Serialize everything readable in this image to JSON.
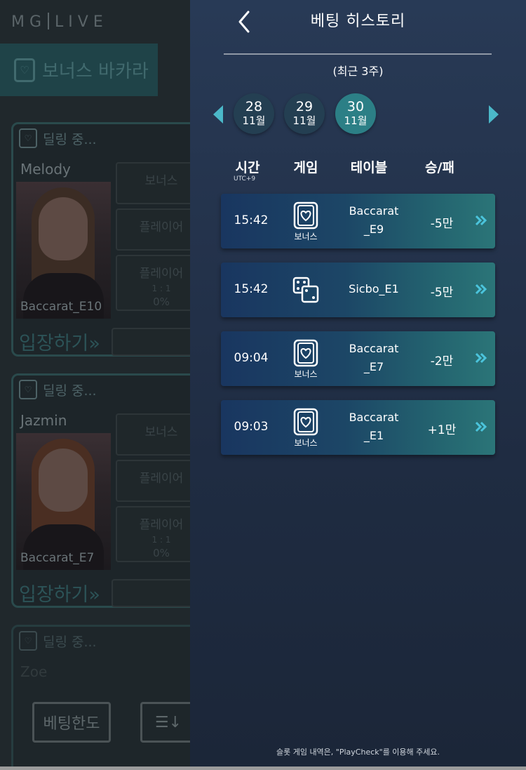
{
  "background": {
    "logo_left": "MG",
    "logo_right": "LIVE",
    "game_tab": "보너스 바카라",
    "cards": [
      {
        "status": "딜링 중...",
        "dealer": "Melody",
        "table": "Baccarat_E10",
        "enter": "입장하기»",
        "btn1": "보너스",
        "btn2": "플레이어",
        "btn3": "플레이어",
        "btn3_sub": "1 : 1",
        "btn3_pct": "0%"
      },
      {
        "status": "딜링 중...",
        "dealer": "Jazmin",
        "table": "Baccarat_E7",
        "enter": "입장하기»",
        "btn1": "보너스",
        "btn2": "플레이어",
        "btn3": "플레이어",
        "btn3_sub": "1 : 1",
        "btn3_pct": "0%"
      },
      {
        "status": "딜링 중...",
        "dealer": "Zoe"
      }
    ],
    "bet_limit_button": "베팅한도",
    "sort_icon": "sort-icon"
  },
  "panel": {
    "title": "베팅 히스토리",
    "subtitle": "(최근 3주)",
    "dates": [
      {
        "day": "28",
        "month": "11월",
        "selected": false
      },
      {
        "day": "29",
        "month": "11월",
        "selected": false
      },
      {
        "day": "30",
        "month": "11월",
        "selected": true
      }
    ],
    "columns": {
      "time": "시간",
      "tz": "UTC+9",
      "game": "게임",
      "table": "테이블",
      "result": "승/패"
    },
    "rows": [
      {
        "time": "15:42",
        "game_icon": "baccarat-card-icon",
        "game_label": "보너스",
        "table_line1": "Baccarat",
        "table_line2": "_E9",
        "result": "-5만"
      },
      {
        "time": "15:42",
        "game_icon": "dice-icon",
        "game_label": "",
        "table_line1": "Sicbo_E1",
        "table_line2": "",
        "result": "-5만"
      },
      {
        "time": "09:04",
        "game_icon": "baccarat-card-icon",
        "game_label": "보너스",
        "table_line1": "Baccarat",
        "table_line2": "_E7",
        "result": "-2만"
      },
      {
        "time": "09:03",
        "game_icon": "baccarat-card-icon",
        "game_label": "보너스",
        "table_line1": "Baccarat",
        "table_line2": "_E1",
        "result": "+1만"
      }
    ],
    "footer_note": "슬롯 게임 내역은, \"PlayCheck\"를 이용해 주세요."
  },
  "colors": {
    "accent": "#4bb8c9",
    "selected_date": "#2c7f86",
    "date": "#243f52",
    "panel_top": "#283a56"
  }
}
